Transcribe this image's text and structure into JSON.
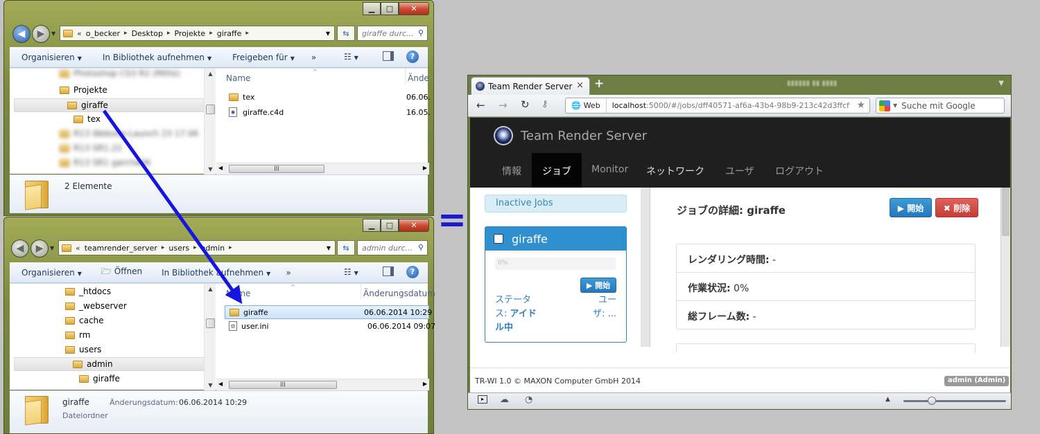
{
  "explorer_top": {
    "breadcrumb": [
      "o_becker",
      "Desktop",
      "Projekte",
      "giraffe"
    ],
    "search_placeholder": "giraffe durc...",
    "toolbar": {
      "organize": "Organisieren",
      "library": "In Bibliothek aufnehmen",
      "share": "Freigeben für",
      "more": "»"
    },
    "tree": {
      "blurred_1": "Photoshop CS3 R2 (Mitte)",
      "projekte": "Projekte",
      "giraffe": "giraffe",
      "tex": "tex",
      "blurred_2": "R13 Website-Launch 23 17.06",
      "blurred_3": "R13 SR1.22",
      "blurred_4": "R13 SR1 garcha06"
    },
    "columns": {
      "name": "Name",
      "date": "Ände"
    },
    "files": [
      {
        "name": "tex",
        "date": "06.06."
      },
      {
        "name": "giraffe.c4d",
        "date": "16.05."
      }
    ],
    "status": "2 Elemente"
  },
  "explorer_bottom": {
    "breadcrumb": [
      "teamrender_server",
      "users",
      "admin"
    ],
    "search_placeholder": "admin durc...",
    "toolbar": {
      "organize": "Organisieren",
      "open": "Öffnen",
      "library": "In Bibliothek aufnehmen",
      "more": "»"
    },
    "tree": {
      "htdocs": "_htdocs",
      "webserver": "_webserver",
      "cache": "cache",
      "rm": "rm",
      "users": "users",
      "admin": "admin",
      "giraffe": "giraffe"
    },
    "columns": {
      "name": "Name",
      "date": "Änderungsdatum"
    },
    "files": [
      {
        "name": "giraffe",
        "date": "06.06.2014 10:29"
      },
      {
        "name": "user.ini",
        "date": "06.06.2014 09:07"
      }
    ],
    "details": {
      "name": "giraffe",
      "date_label": "Änderungsdatum:",
      "date_value": "06.06.2014 10:29",
      "type": "Dateiordner"
    }
  },
  "equals_sign": "=",
  "browser": {
    "tab_title": "Team Render Server",
    "tab_close": "×",
    "new_tab": "+",
    "url_label": "Web",
    "url_host": "localhost",
    "url_path": ":5000/#/jobs/dff40571-af6a-43b4-98b9-213c42d3ffcf",
    "google_placeholder": "Suche mit Google",
    "page": {
      "brand": "Team Render Server",
      "nav": [
        "情報",
        "ジョブ",
        "Monitor",
        "ネットワーク",
        "ユーザ",
        "ログアウト"
      ],
      "inactive_jobs": "Inactive Jobs",
      "job_card": {
        "title": "giraffe",
        "progress_text": "0%",
        "start_button": "▶ 開始",
        "status_line1": "ステータ",
        "status_line2_label": "ス: ",
        "status_line2_value": "アイド",
        "status_line3_value": "ル中",
        "user_line1": "ユー",
        "user_line2": "ザ: ..."
      },
      "detail_title": "ジョブの詳細: giraffe",
      "start_button": "▶ 開始",
      "delete_button": "✖ 削除",
      "rows": [
        {
          "label": "レンダリング時間:",
          "value": " -"
        },
        {
          "label": "作業状況:",
          "value": " 0%"
        },
        {
          "label": "総フレーム数:",
          "value": " -"
        }
      ],
      "footer": "TR-WI 1.0 © MAXON Computer GmbH 2014",
      "user_badge": "admin (Admin)"
    }
  }
}
